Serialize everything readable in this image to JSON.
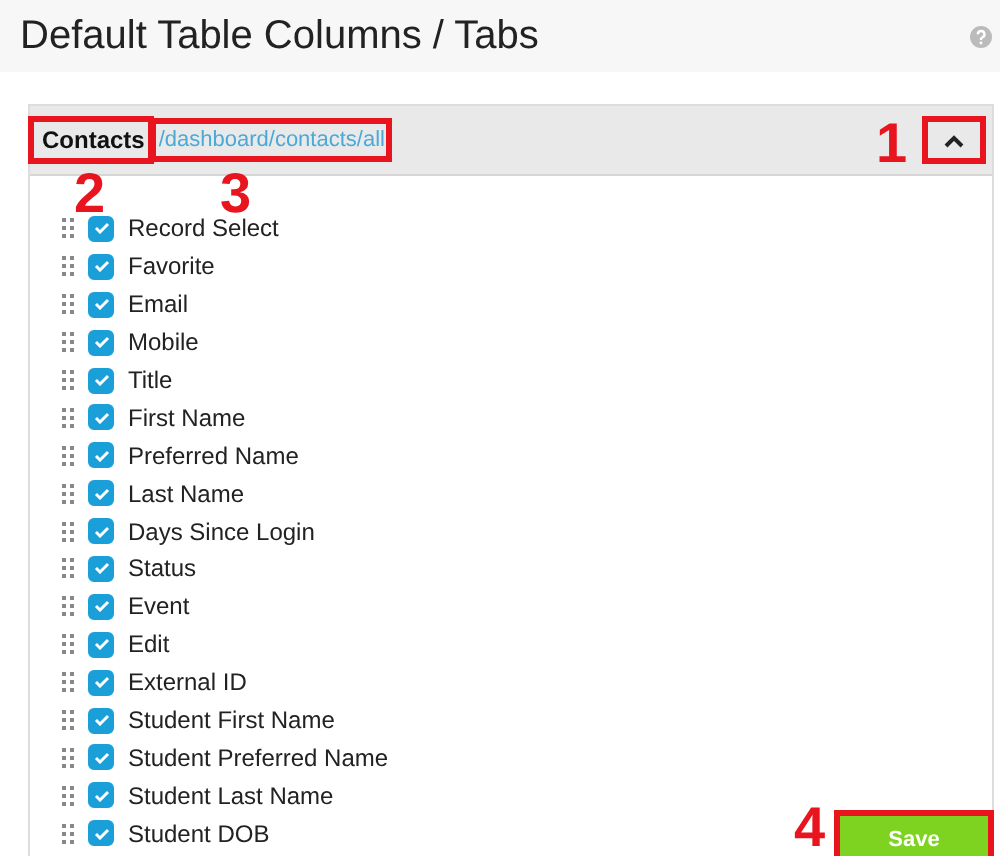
{
  "page": {
    "title": "Default Table Columns / Tabs"
  },
  "panel": {
    "name": "Contacts",
    "name_callout": "2",
    "path": "/dashboard/contacts/all",
    "path_callout": "3",
    "expanded": true,
    "toggle_callout": "1",
    "columns": [
      {
        "label": "Record Select",
        "checked": true
      },
      {
        "label": "Favorite",
        "checked": true
      },
      {
        "label": "Email",
        "checked": true
      },
      {
        "label": "Mobile",
        "checked": true
      },
      {
        "label": "Title",
        "checked": true
      },
      {
        "label": "First Name",
        "checked": true
      },
      {
        "label": "Preferred Name",
        "checked": true
      },
      {
        "label": "Last Name",
        "checked": true
      },
      {
        "label": "Days Since Login",
        "checked": true
      },
      {
        "label": "Status",
        "checked": true
      },
      {
        "label": "Event",
        "checked": true
      },
      {
        "label": "Edit",
        "checked": true
      },
      {
        "label": "External ID",
        "checked": true
      },
      {
        "label": "Student First Name",
        "checked": true
      },
      {
        "label": "Student Preferred Name",
        "checked": true
      },
      {
        "label": "Student Last Name",
        "checked": true
      },
      {
        "label": "Student DOB",
        "checked": true
      }
    ]
  },
  "save_button": {
    "label": "Save",
    "callout": "4"
  }
}
